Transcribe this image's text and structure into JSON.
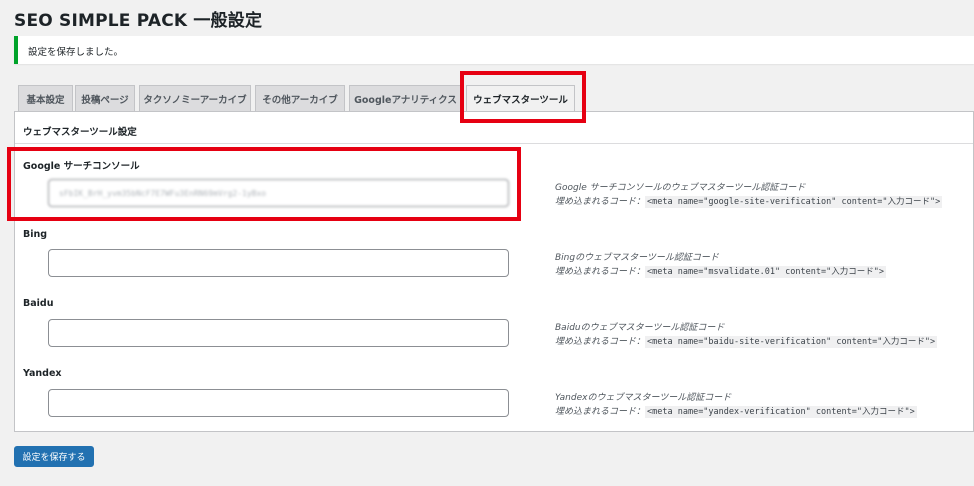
{
  "page_title": "SEO SIMPLE PACK 一般設定",
  "notice": "設定を保存しました。",
  "tabs": [
    {
      "label": "基本設定"
    },
    {
      "label": "投稿ページ"
    },
    {
      "label": "タクソノミーアーカイブ"
    },
    {
      "label": "その他アーカイブ"
    },
    {
      "label": "Googleアナリティクス"
    },
    {
      "label": "ウェブマスターツール"
    }
  ],
  "active_tab": "ウェブマスターツール",
  "section_title": "ウェブマスターツール設定",
  "fields": [
    {
      "label": "Google サーチコンソール",
      "value": "sFbIK_BrH_yvm35bNcF7E7WFu3EnRN69mVrg2-1yBxo",
      "description": "Google サーチコンソールのウェブマスターツール認証コード",
      "code_prefix": "埋め込まれるコード：",
      "code": "<meta name=\"google-site-verification\" content=\"入力コード\">"
    },
    {
      "label": "Bing",
      "value": "",
      "description": "Bingのウェブマスターツール認証コード",
      "code_prefix": "埋め込まれるコード：",
      "code": "<meta name=\"msvalidate.01\" content=\"入力コード\">"
    },
    {
      "label": "Baidu",
      "value": "",
      "description": "Baiduのウェブマスターツール認証コード",
      "code_prefix": "埋め込まれるコード：",
      "code": "<meta name=\"baidu-site-verification\" content=\"入力コード\">"
    },
    {
      "label": "Yandex",
      "value": "",
      "description": "Yandexのウェブマスターツール認証コード",
      "code_prefix": "埋め込まれるコード：",
      "code": "<meta name=\"yandex-verification\" content=\"入力コード\">"
    }
  ],
  "save_button_label": "設定を保存する",
  "colors": {
    "accent": "#2271b1",
    "notice_success": "#00a32a",
    "highlight": "#e60012"
  }
}
